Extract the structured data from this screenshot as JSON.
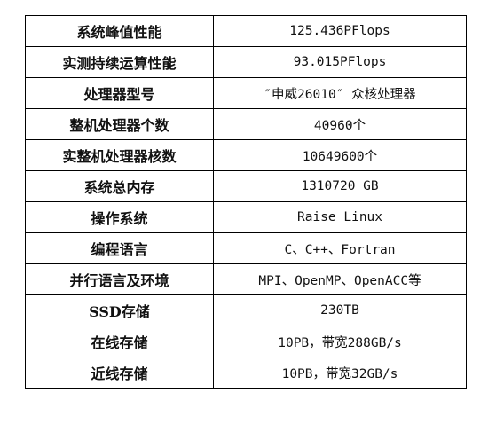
{
  "specs": [
    {
      "label": "系统峰值性能",
      "value": "125.436PFlops"
    },
    {
      "label": "实测持续运算性能",
      "value": "93.015PFlops"
    },
    {
      "label": "处理器型号",
      "value": "″申威26010″ 众核处理器"
    },
    {
      "label": "整机处理器个数",
      "value": "40960个"
    },
    {
      "label": "实整机处理器核数",
      "value": "10649600个"
    },
    {
      "label": "系统总内存",
      "value": "1310720 GB"
    },
    {
      "label": "操作系统",
      "value": "Raise Linux"
    },
    {
      "label": "编程语言",
      "value": "C、C++、Fortran"
    },
    {
      "label": "并行语言及环境",
      "value": "MPI、OpenMP、OpenACC等"
    },
    {
      "label": "SSD存储",
      "value": "230TB"
    },
    {
      "label": "在线存储",
      "value": "10PB，带宽288GB/s"
    },
    {
      "label": "近线存储",
      "value": "10PB，带宽32GB/s"
    }
  ]
}
